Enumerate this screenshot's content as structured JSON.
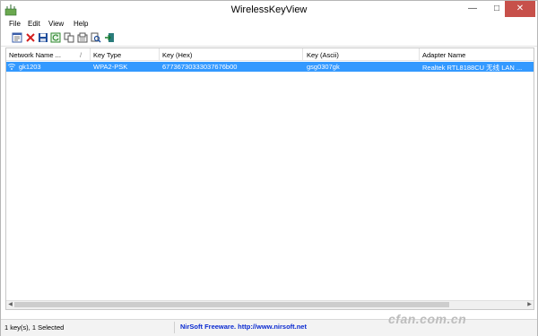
{
  "window": {
    "title": "WirelessKeyView"
  },
  "menu": [
    "File",
    "Edit",
    "View",
    "Help"
  ],
  "toolbar": {
    "icons": [
      "properties-icon",
      "delete-icon",
      "save-icon",
      "refresh-icon",
      "copy-icon",
      "export-icon",
      "search-icon",
      "exit-icon"
    ]
  },
  "columns": [
    "Network Name ...",
    "Key Type",
    "Key (Hex)",
    "Key (Ascii)",
    "Adapter Name"
  ],
  "sort_indicator": "/",
  "rows": [
    {
      "network": "gk1203",
      "key_type": "WPA2-PSK",
      "key_hex": "67736730333037676b00",
      "key_ascii": "gsg0307gk",
      "adapter": "Realtek RTL8188CU 无线 LAN ..."
    }
  ],
  "status": {
    "count": "1 key(s), 1 Selected",
    "link": "NirSoft Freeware.  http://www.nirsoft.net"
  },
  "watermark": "cfan.com.cn",
  "colors": {
    "selection": "#3399ff",
    "close": "#c7504a",
    "link": "#0b2bd1"
  }
}
